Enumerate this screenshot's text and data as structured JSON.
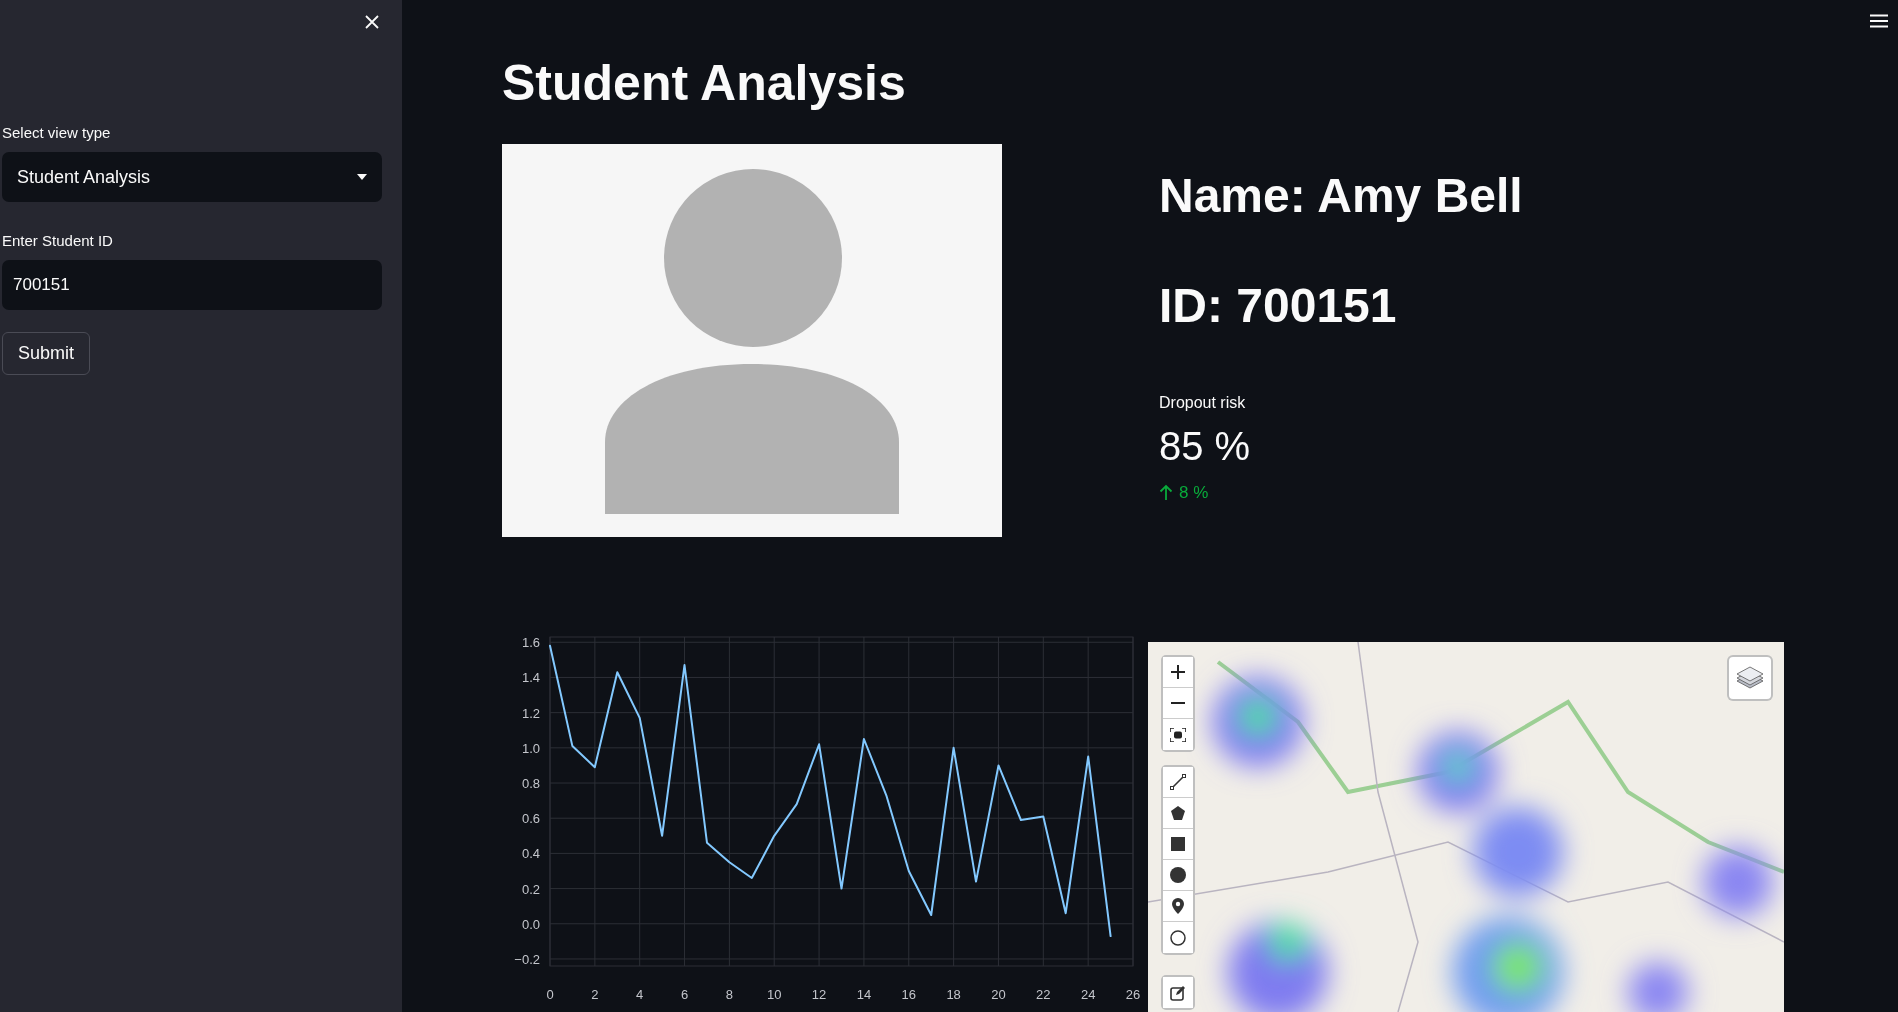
{
  "sidebar": {
    "view_select": {
      "label": "Select view type",
      "value": "Student Analysis"
    },
    "student_id": {
      "label": "Enter Student ID",
      "value": "700151"
    },
    "submit_button": "Submit"
  },
  "main": {
    "title": "Student Analysis",
    "name": "Name: Amy Bell",
    "id": "ID: 700151",
    "metric": {
      "label": "Dropout risk",
      "value": "85 %",
      "delta": "8 %",
      "delta_rising": true
    },
    "chart_data": {
      "type": "line",
      "x": [
        0,
        1,
        2,
        3,
        4,
        5,
        6,
        7,
        8,
        9,
        10,
        11,
        12,
        13,
        14,
        15,
        16,
        17,
        18,
        19,
        20,
        21,
        22,
        23,
        24,
        25
      ],
      "grid": true,
      "series": [
        {
          "color": "#83c9ff",
          "values": [
            1.58,
            1.01,
            0.89,
            1.43,
            1.17,
            0.5,
            1.47,
            0.46,
            0.35,
            0.26,
            0.5,
            0.68,
            1.02,
            0.2,
            1.05,
            0.73,
            0.3,
            0.05,
            1.0,
            0.24,
            0.9,
            0.59,
            0.61,
            0.06,
            0.95,
            -0.07
          ]
        }
      ],
      "xlim": [
        0,
        26
      ],
      "ylim": [
        -0.24,
        1.63
      ],
      "xticks": [
        0,
        2,
        4,
        6,
        8,
        10,
        12,
        14,
        16,
        18,
        20,
        22,
        24,
        26
      ],
      "yticks": [
        {
          "value": -0.2,
          "label": "−0.2"
        },
        {
          "value": 0,
          "label": "0.0"
        },
        {
          "value": 0.2,
          "label": "0.2"
        },
        {
          "value": 0.4,
          "label": "0.4"
        },
        {
          "value": 0.6,
          "label": "0.6"
        },
        {
          "value": 0.8,
          "label": "0.8"
        },
        {
          "value": 1,
          "label": "1.0"
        },
        {
          "value": 1.2,
          "label": "1.2"
        },
        {
          "value": 1.4,
          "label": "1.4"
        },
        {
          "value": 1.6,
          "label": "1.6"
        }
      ]
    }
  }
}
